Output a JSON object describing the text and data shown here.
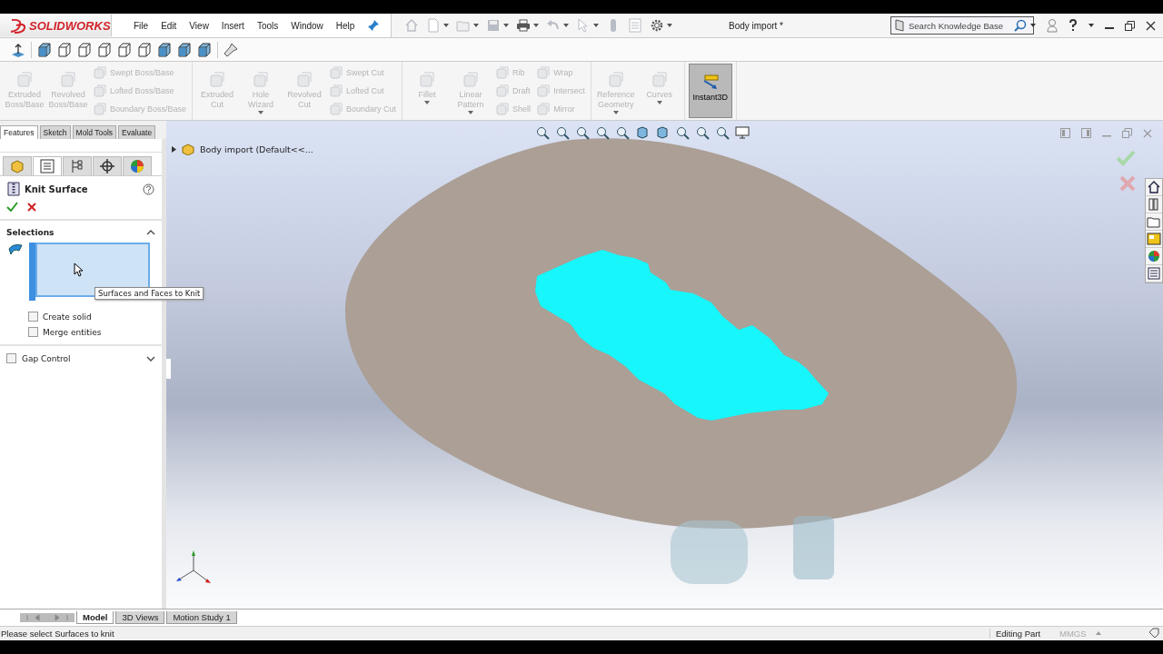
{
  "app": {
    "brand": "SOLIDWORKS",
    "menu": [
      "File",
      "Edit",
      "View",
      "Insert",
      "Tools",
      "Window",
      "Help"
    ],
    "title": "Body import *",
    "search": {
      "placeholder": "Search Knowledge Base"
    }
  },
  "ribbon": [
    {
      "columns": [
        {
          "kind": "large",
          "label": "Extruded Boss/Base",
          "disabled": true
        },
        {
          "kind": "large",
          "label": "Revolved Boss/Base",
          "disabled": true
        },
        {
          "kind": "stack",
          "items": [
            {
              "label": "Swept Boss/Base",
              "disabled": true
            },
            {
              "label": "Lofted Boss/Base",
              "disabled": true
            },
            {
              "label": "Boundary Boss/Base",
              "disabled": true
            }
          ]
        }
      ]
    },
    {
      "columns": [
        {
          "kind": "large",
          "label": "Extruded Cut",
          "disabled": true
        },
        {
          "kind": "large",
          "label": "Hole Wizard",
          "disabled": true,
          "dropdown": true
        },
        {
          "kind": "large",
          "label": "Revolved Cut",
          "disabled": true
        },
        {
          "kind": "stack",
          "items": [
            {
              "label": "Swept Cut",
              "disabled": true
            },
            {
              "label": "Lofted Cut",
              "disabled": true
            },
            {
              "label": "Boundary Cut",
              "disabled": true
            }
          ]
        }
      ]
    },
    {
      "columns": [
        {
          "kind": "large",
          "label": "Fillet",
          "disabled": true,
          "dropdown": true
        },
        {
          "kind": "large",
          "label": "Linear Pattern",
          "disabled": true,
          "dropdown": true
        },
        {
          "kind": "stack",
          "items": [
            {
              "label": "Rib",
              "disabled": true
            },
            {
              "label": "Draft",
              "disabled": true
            },
            {
              "label": "Shell",
              "disabled": true
            }
          ]
        },
        {
          "kind": "stack",
          "items": [
            {
              "label": "Wrap",
              "disabled": true
            },
            {
              "label": "Intersect",
              "disabled": true
            },
            {
              "label": "Mirror",
              "disabled": true
            }
          ]
        }
      ]
    },
    {
      "columns": [
        {
          "kind": "large",
          "label": "Reference Geometry",
          "disabled": true,
          "dropdown": true
        },
        {
          "kind": "large",
          "label": "Curves",
          "disabled": true,
          "dropdown": true
        }
      ]
    },
    {
      "columns": [
        {
          "kind": "large",
          "label": "Instant3D",
          "disabled": false,
          "selected": true
        }
      ]
    }
  ],
  "command_tabs": [
    {
      "label": "Features",
      "selected": true
    },
    {
      "label": "Sketch",
      "selected": false
    },
    {
      "label": "Mold Tools",
      "selected": false
    },
    {
      "label": "Evaluate",
      "selected": false
    }
  ],
  "panel_tabs": [
    {
      "selected": false
    },
    {
      "selected": true
    },
    {
      "selected": false
    },
    {
      "selected": false
    },
    {
      "selected": false
    }
  ],
  "property_manager": {
    "title": "Knit Surface",
    "sections": [
      {
        "title": "Selections",
        "expanded": true
      }
    ],
    "tooltip": "Surfaces and Faces to Knit",
    "options": [
      {
        "label": "Create solid",
        "checked": false
      },
      {
        "label": "Merge entities",
        "checked": false
      }
    ],
    "gap_control": {
      "label": "Gap Control",
      "checked": false,
      "expanded": false
    }
  },
  "tree": {
    "label": "Body import  (Default<<...",
    "expanded": false
  },
  "bottom_tabs": [
    {
      "label": "Model",
      "selected": true
    },
    {
      "label": "3D Views",
      "selected": false
    },
    {
      "label": "Motion Study 1",
      "selected": false
    }
  ],
  "status_bar": {
    "message": "Please select Surfaces to knit",
    "mode": "Editing Part",
    "units": "MMGS"
  }
}
